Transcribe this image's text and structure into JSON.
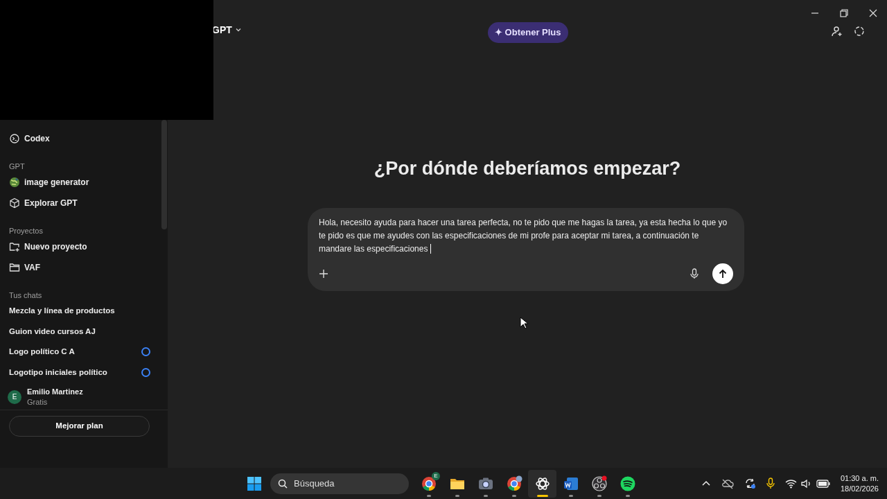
{
  "header": {
    "model": "GPT",
    "upgrade": "✦ Obtener Plus"
  },
  "sidebar": {
    "top_items": [
      {
        "label": "Codex",
        "kind": "codex"
      }
    ],
    "gpt_heading": "GPT",
    "gpt_items": [
      {
        "label": "image generator",
        "kind": "globe"
      },
      {
        "label": "Explorar GPT",
        "kind": "cube"
      }
    ],
    "projects_heading": "Proyectos",
    "project_items": [
      {
        "label": "Nuevo proyecto",
        "kind": "new-folder"
      },
      {
        "label": "VAF",
        "kind": "folder"
      }
    ],
    "chats_heading": "Tus chats",
    "chats": [
      {
        "label": "Mezcla y línea de productos",
        "pending": false
      },
      {
        "label": "Guion video cursos AJ",
        "pending": false
      },
      {
        "label": "Logo político C A",
        "pending": true
      },
      {
        "label": "Logotipo iniciales político",
        "pending": true
      }
    ],
    "user": {
      "initial": "E",
      "name": "Emilio Martinez",
      "plan": "Gratis"
    },
    "upgrade_button": "Mejorar plan"
  },
  "main": {
    "heading": "¿Por dónde deberíamos empezar?",
    "composer_value": "Hola, necesito ayuda para hacer una tarea perfecta, no te pido que me hagas la tarea, ya esta hecha lo que yo te pido es que me ayudes con las especificaciones de mi profe para aceptar mi tarea, a continuación te mandare las especificaciones "
  },
  "taskbar": {
    "search_placeholder": "Búsqueda",
    "apps": [
      {
        "kind": "chrome",
        "badge": "E",
        "active": false
      },
      {
        "kind": "folder",
        "active": false
      },
      {
        "kind": "camera",
        "active": false
      },
      {
        "kind": "chrome-avatar",
        "active": false
      },
      {
        "kind": "chatgpt",
        "active": true
      },
      {
        "kind": "word",
        "active": false
      },
      {
        "kind": "obs",
        "active": false
      },
      {
        "kind": "spotify",
        "active": false
      }
    ],
    "time": "01:30 a. m.",
    "date": "18/02/2026"
  }
}
